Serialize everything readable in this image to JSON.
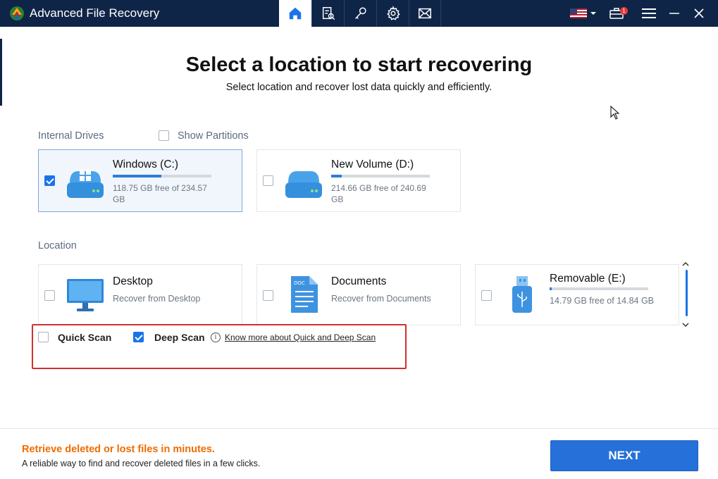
{
  "app": {
    "title": "Advanced File Recovery"
  },
  "nav": {
    "tabs": [
      {
        "icon": "home-icon",
        "active": true
      },
      {
        "icon": "scan-log-icon",
        "active": false
      },
      {
        "icon": "key-icon",
        "active": false
      },
      {
        "icon": "gear-icon",
        "active": false
      },
      {
        "icon": "mail-icon",
        "active": false
      }
    ],
    "notification_count": "1"
  },
  "colors": {
    "titlebar": "#0f2548",
    "accent": "#1a73e8",
    "next_button": "#2571d9",
    "footer_headline": "#ef6c00",
    "highlight_border": "#d32f2f"
  },
  "header": {
    "title": "Select a location to start recovering",
    "subtitle": "Select location and recover lost data quickly and efficiently."
  },
  "internal_drives": {
    "label": "Internal Drives",
    "show_partitions_label": "Show Partitions",
    "show_partitions_checked": false,
    "drives": [
      {
        "name": "Windows (C:)",
        "free_text": "118.75 GB free of 234.57 GB",
        "used_fraction": 0.49,
        "checked": true
      },
      {
        "name": "New Volume (D:)",
        "free_text": "214.66 GB free of 240.69 GB",
        "used_fraction": 0.11,
        "checked": false
      }
    ]
  },
  "location": {
    "label": "Location",
    "items": [
      {
        "name": "Desktop",
        "sub": "Recover from Desktop",
        "checked": false
      },
      {
        "name": "Documents",
        "sub": "Recover from Documents",
        "checked": false
      },
      {
        "name": "Removable (E:)",
        "sub": "14.79 GB free of 14.84 GB",
        "used_fraction": 0.003,
        "checked": false
      }
    ]
  },
  "scan": {
    "quick_label": "Quick Scan",
    "quick_checked": false,
    "deep_label": "Deep Scan",
    "deep_checked": true,
    "info_glyph": "i",
    "know_more_label": "Know more about Quick and Deep Scan"
  },
  "footer": {
    "headline": "Retrieve deleted or lost files in minutes.",
    "subtext": "A reliable way to find and recover deleted files in a few clicks.",
    "next_label": "NEXT"
  }
}
